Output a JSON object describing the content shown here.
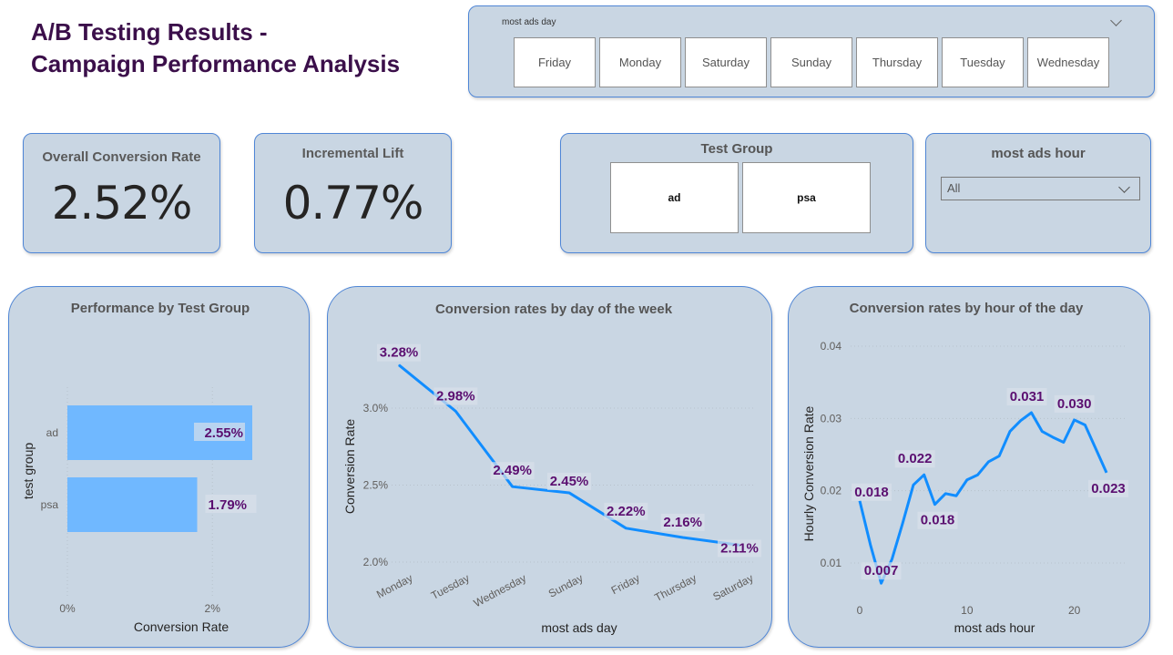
{
  "header": {
    "title_line1": "A/B Testing Results -",
    "title_line2": "Campaign Performance Analysis"
  },
  "day_slicer": {
    "title": "most ads day",
    "options": [
      "Friday",
      "Monday",
      "Saturday",
      "Sunday",
      "Thursday",
      "Tuesday",
      "Wednesday"
    ],
    "icon": "chevron-down-icon"
  },
  "kpis": {
    "overall": {
      "label": "Overall Conversion Rate",
      "value": "2.52%"
    },
    "lift": {
      "label": "Incremental Lift",
      "value": "0.77%"
    }
  },
  "test_group_slicer": {
    "title": "Test Group",
    "options": [
      "ad",
      "psa"
    ]
  },
  "hour_slicer": {
    "title": "most ads hour",
    "selected": "All",
    "icon": "chevron-down-icon"
  },
  "colors": {
    "card_bg": "#c9d6e3",
    "card_border": "#4f86d6",
    "bar": "#70b8ff",
    "line": "#118dff",
    "data_label": "#5b0f70",
    "title": "#3b0f4a"
  },
  "chart_data": [
    {
      "type": "bar",
      "orientation": "horizontal",
      "title": "Performance by Test Group",
      "xlabel": "Conversion Rate",
      "ylabel": "test group",
      "categories": [
        "ad",
        "psa"
      ],
      "values": [
        2.55,
        1.79
      ],
      "data_labels": [
        "2.55%",
        "1.79%"
      ],
      "x_ticks": [
        "0%",
        "2%"
      ],
      "xlim": [
        0,
        2.55
      ],
      "grid": true
    },
    {
      "type": "line",
      "title": "Conversion rates by day of the week",
      "xlabel": "most ads day",
      "ylabel": "Conversion Rate",
      "categories": [
        "Monday",
        "Tuesday",
        "Wednesday",
        "Sunday",
        "Friday",
        "Thursday",
        "Saturday"
      ],
      "values": [
        3.28,
        2.98,
        2.49,
        2.45,
        2.22,
        2.16,
        2.11
      ],
      "data_labels": [
        "3.28%",
        "2.98%",
        "2.49%",
        "2.45%",
        "2.22%",
        "2.16%",
        "2.11%"
      ],
      "y_ticks": [
        "2.0%",
        "2.5%",
        "3.0%"
      ],
      "ylim": [
        2.0,
        3.0
      ],
      "grid": true
    },
    {
      "type": "line",
      "title": "Conversion rates by hour of the day",
      "xlabel": "most ads hour",
      "ylabel": "Hourly Conversion Rate",
      "x": [
        0,
        1,
        2,
        3,
        4,
        5,
        6,
        7,
        8,
        9,
        10,
        11,
        12,
        13,
        14,
        15,
        16,
        17,
        18,
        19,
        20,
        21,
        22,
        23
      ],
      "values": [
        0.0186,
        0.0125,
        0.0072,
        0.0105,
        0.0155,
        0.0208,
        0.0222,
        0.0181,
        0.0196,
        0.0193,
        0.0215,
        0.0222,
        0.024,
        0.0248,
        0.0282,
        0.0297,
        0.0308,
        0.0282,
        0.0274,
        0.0267,
        0.0298,
        0.0291,
        0.0258,
        0.0225
      ],
      "labeled_points": [
        {
          "x": 0,
          "label": "0.018"
        },
        {
          "x": 2,
          "label": "0.007"
        },
        {
          "x": 6,
          "label": "0.022"
        },
        {
          "x": 7,
          "label": "0.018"
        },
        {
          "x": 16,
          "label": "0.031"
        },
        {
          "x": 20,
          "label": "0.030"
        },
        {
          "x": 23,
          "label": "0.023"
        }
      ],
      "y_ticks": [
        "0.01",
        "0.02",
        "0.03",
        "0.04"
      ],
      "x_ticks": [
        "0",
        "10",
        "20"
      ],
      "xlim": [
        0,
        23
      ],
      "ylim": [
        0.01,
        0.04
      ],
      "grid": true
    }
  ]
}
